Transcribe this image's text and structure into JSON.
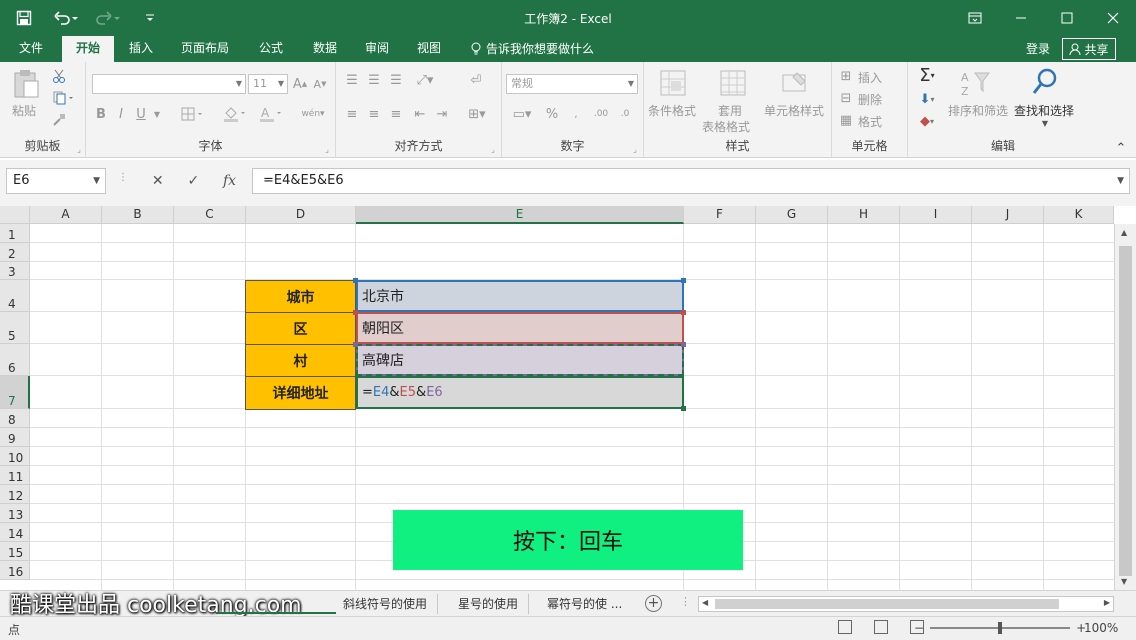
{
  "window": {
    "title": "工作簿2 - Excel"
  },
  "tabs": {
    "file": "文件",
    "home": "开始",
    "insert": "插入",
    "layout": "页面布局",
    "formulas": "公式",
    "data": "数据",
    "review": "审阅",
    "view": "视图",
    "tellme": "告诉我你想要做什么",
    "login": "登录",
    "share": "共享"
  },
  "ribbon": {
    "clipboard": {
      "paste": "粘贴",
      "label": "剪贴板"
    },
    "font": {
      "name": "",
      "size": "11",
      "label": "字体",
      "bold": "B",
      "italic": "I",
      "underline": "U"
    },
    "alignment": {
      "label": "对齐方式"
    },
    "number": {
      "format": "常规",
      "label": "数字",
      "percent": "%"
    },
    "styles": {
      "conditional": "条件格式",
      "table1": "套用",
      "table2": "表格格式",
      "cell_styles": "单元格样式",
      "label": "样式"
    },
    "cells": {
      "insert": "插入",
      "delete": "删除",
      "format": "格式",
      "label": "单元格"
    },
    "editing": {
      "sort": "排序和筛选",
      "find": "查找和选择",
      "label": "编辑"
    }
  },
  "formula_bar": {
    "namebox": "E6",
    "formula": "=E4&E5&E6",
    "fx": "fx"
  },
  "columns": [
    "A",
    "B",
    "C",
    "D",
    "E",
    "F",
    "G",
    "H",
    "I",
    "J",
    "K"
  ],
  "rows": [
    "1",
    "2",
    "3",
    "4",
    "5",
    "6",
    "7",
    "8",
    "9",
    "10",
    "11",
    "12",
    "13",
    "14",
    "15",
    "16"
  ],
  "cells": {
    "d4": "城市",
    "e4": "北京市",
    "d5": "区",
    "e5": "朝阳区",
    "d6": "村",
    "e6": "高碑店",
    "d7": "详细地址",
    "e7_eq": "=",
    "e7_ref1": "E4",
    "e7_amp1": "&",
    "e7_ref2": "E5",
    "e7_amp2": "&",
    "e7_ref3": "E6"
  },
  "overlay": {
    "key_hint": "按下：回车"
  },
  "sheets": {
    "watermark": "酷课堂出品 coolketang.com",
    "tab1": "斜线符号的使用",
    "tab2": "星号的使用",
    "tab3": "幂符号的使 ..."
  },
  "status": {
    "mode": "点",
    "zoom": "100%"
  },
  "colors": {
    "brand": "#217346",
    "label_fill": "#ffc000",
    "ref1": "#2e75b6",
    "ref2": "#c0504d",
    "ref3": "#8064a2",
    "hint_bg": "#10f080"
  }
}
